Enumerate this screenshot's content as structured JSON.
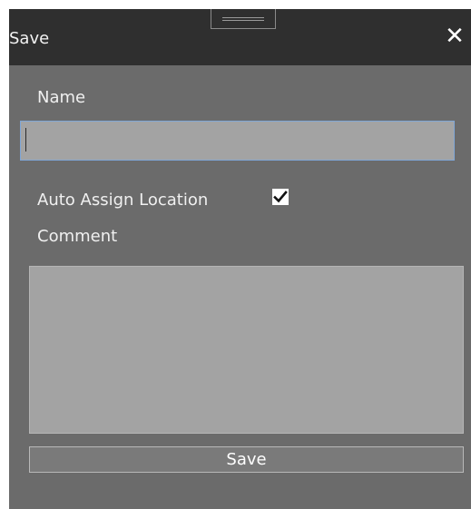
{
  "dialog": {
    "title": "Save",
    "close_glyph": "✕",
    "colors": {
      "titlebar": "#2f2f2f",
      "body": "#6b6b6b",
      "input": "#a3a3a3",
      "focus_border": "#7fa6d6"
    }
  },
  "form": {
    "name_label": "Name",
    "name_value": "",
    "auto_assign_label": "Auto Assign Location",
    "auto_assign_checked": true,
    "comment_label": "Comment",
    "comment_value": ""
  },
  "actions": {
    "save_label": "Save"
  },
  "icons": {
    "close": "close-icon",
    "check": "checkmark-icon",
    "drag": "drag-handle-icon"
  }
}
